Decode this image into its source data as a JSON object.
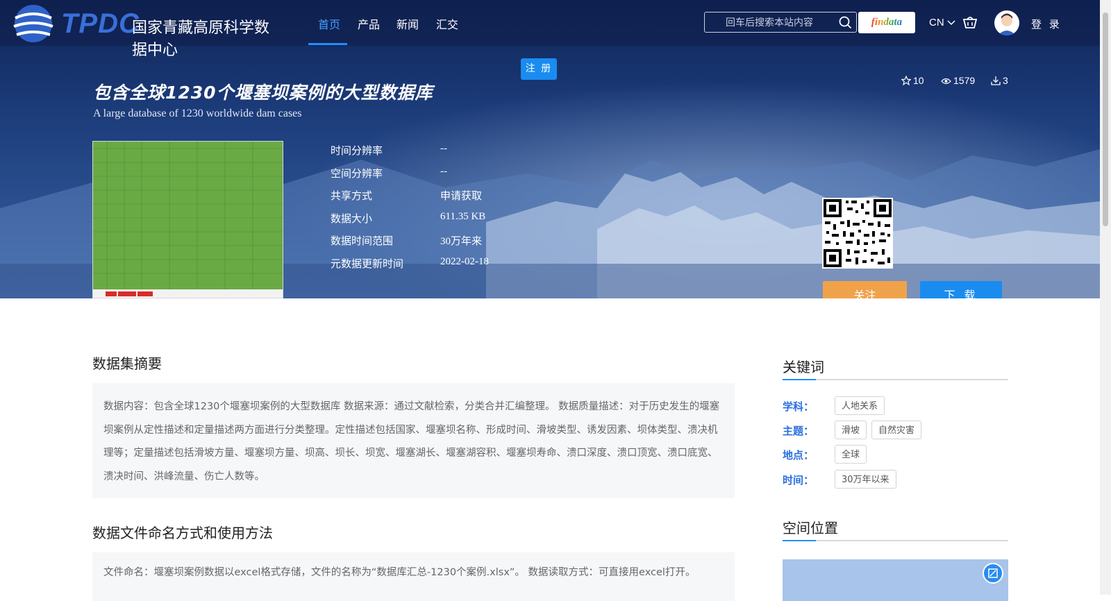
{
  "header": {
    "logo_mark": "TPDC",
    "logo_text": "国家青藏高原科学数据中心",
    "nav": [
      {
        "label": "首页",
        "active": true
      },
      {
        "label": "产品"
      },
      {
        "label": "新闻"
      },
      {
        "label": "汇交"
      }
    ],
    "search_placeholder": "回车后搜索本站内容",
    "findata_label": "findata",
    "lang_label": "CN",
    "login_label": "登 录",
    "register_label": "注 册"
  },
  "dataset": {
    "title_cn": "包含全球1230个堰塞坝案例的大型数据库",
    "title_en": "A large database of 1230 worldwide dam cases",
    "stats": {
      "favorites": "10",
      "views": "1579",
      "downloads": "3"
    },
    "info": [
      {
        "label": "时间分辨率",
        "value": "--"
      },
      {
        "label": "空间分辨率",
        "value": "--"
      },
      {
        "label": "共享方式",
        "value": "申请获取"
      },
      {
        "label": "数据大小",
        "value": "611.35 KB"
      },
      {
        "label": "数据时间范围",
        "value": "30万年来"
      },
      {
        "label": "元数据更新时间",
        "value": "2022-02-18"
      }
    ],
    "follow_label": "关注",
    "download_label": "下 载"
  },
  "main": {
    "abstract_title": "数据集摘要",
    "abstract_text": "数据内容：包含全球1230个堰塞坝案例的大型数据库 数据来源：通过文献检索，分类合并汇编整理。 数据质量描述：对于历史发生的堰塞坝案例从定性描述和定量描述两方面进行分类整理。定性描述包括国家、堰塞坝名称、形成时间、滑坡类型、诱发因素、坝体类型、溃决机理等；定量描述包括滑坡方量、堰塞坝方量、坝高、坝长、坝宽、堰塞湖长、堰塞湖容积、堰塞坝寿命、溃口深度、溃口顶宽、溃口底宽、溃决时间、洪峰流量、伤亡人数等。",
    "usage_title": "数据文件命名方式和使用方法",
    "usage_text": "文件命名：堰塞坝案例数据以excel格式存储，文件的名称为“数据库汇总-1230个案例.xlsx”。 数据读取方式：可直接用excel打开。"
  },
  "sidebar": {
    "keywords_title": "关键词",
    "keywords": [
      {
        "label": "学科：",
        "tags": [
          "人地关系"
        ]
      },
      {
        "label": "主题：",
        "tags": [
          "滑坡",
          "自然灾害"
        ]
      },
      {
        "label": "地点：",
        "tags": [
          "全球"
        ]
      },
      {
        "label": "时间：",
        "tags": [
          "30万年以来"
        ]
      }
    ],
    "location_title": "空间位置"
  },
  "colors": {
    "accent": "#1a8cf0",
    "follow": "#f0a24a",
    "keyword_label": "#2a6fe0",
    "nav_active": "#3fa0ff"
  }
}
